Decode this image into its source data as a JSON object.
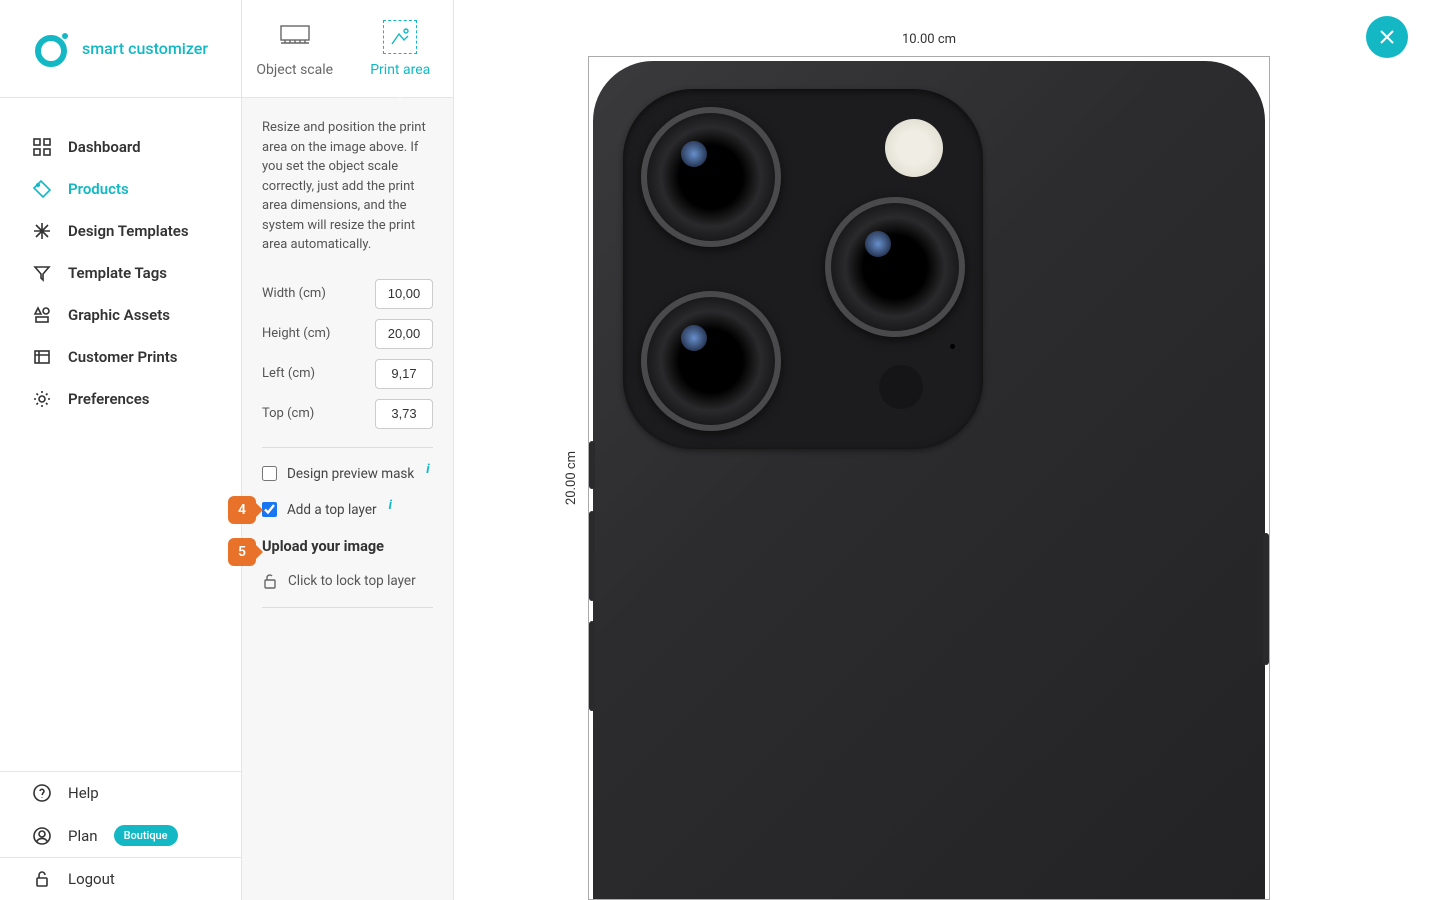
{
  "brand": "smart customizer",
  "nav": {
    "items": [
      {
        "label": "Dashboard"
      },
      {
        "label": "Products"
      },
      {
        "label": "Design Templates"
      },
      {
        "label": "Template Tags"
      },
      {
        "label": "Graphic Assets"
      },
      {
        "label": "Customer Prints"
      },
      {
        "label": "Preferences"
      }
    ],
    "help": "Help",
    "plan": "Plan",
    "plan_badge": "Boutique",
    "logout": "Logout"
  },
  "tabs": {
    "object_scale": "Object scale",
    "print_area": "Print area"
  },
  "panel": {
    "description": "Resize and position the print area on the image above. If you set the object scale correctly, just add the print area dimensions, and the system will resize the print area automatically.",
    "width_label": "Width (cm)",
    "width_value": "10,00",
    "height_label": "Height (cm)",
    "height_value": "20,00",
    "left_label": "Left (cm)",
    "left_value": "9,17",
    "top_label": "Top (cm)",
    "top_value": "3,73",
    "mask_label": "Design preview mask",
    "toplayer_label": "Add a top layer",
    "upload_label": "Upload your image",
    "lock_label": "Click to lock top layer"
  },
  "markers": {
    "step4": "4",
    "step5": "5"
  },
  "canvas": {
    "width_ruler": "10.00 cm",
    "height_ruler": "20.00 cm"
  }
}
